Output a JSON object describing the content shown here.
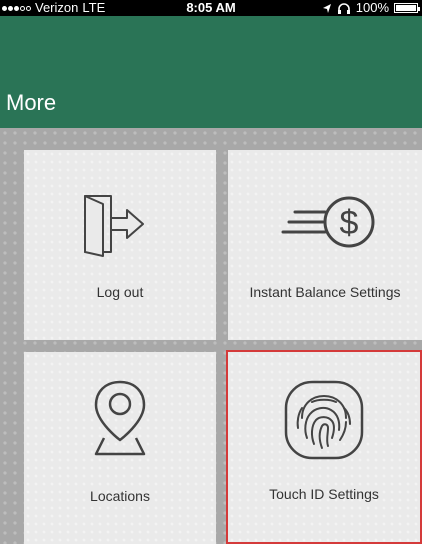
{
  "status_bar": {
    "carrier": "Verizon",
    "network": "LTE",
    "time": "8:05 AM",
    "battery": "100%"
  },
  "header": {
    "title": "More"
  },
  "tiles": [
    {
      "label": "Log out",
      "icon": "logout-door-icon"
    },
    {
      "label": "Instant Balance Settings",
      "icon": "dollar-speed-icon"
    },
    {
      "label": "Locations",
      "icon": "location-pin-icon"
    },
    {
      "label": "Touch ID Settings",
      "icon": "fingerprint-icon"
    }
  ],
  "colors": {
    "header": "#2a7456",
    "selected_border": "#d43a3a",
    "tile_bg": "#eaeaea"
  }
}
